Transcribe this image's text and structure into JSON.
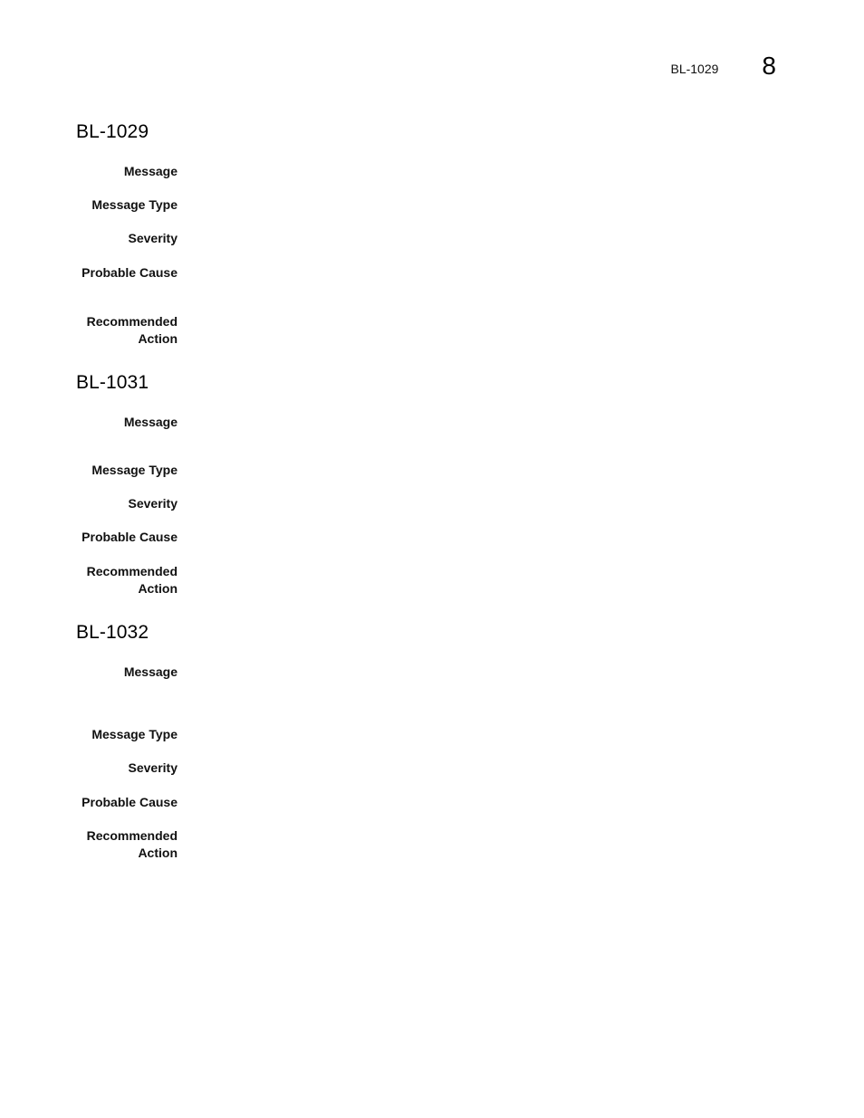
{
  "header": {
    "running_title": "BL-1029",
    "chapter_number": "8"
  },
  "sections": [
    {
      "title": "BL-1029",
      "fields": [
        {
          "label": "Message",
          "value": ""
        },
        {
          "label": "Message Type",
          "value": ""
        },
        {
          "label": "Severity",
          "value": ""
        },
        {
          "label": "Probable Cause",
          "value": ""
        },
        {
          "label_line1": "Recommended",
          "label_line2": "Action",
          "value": ""
        }
      ]
    },
    {
      "title": "BL-1031",
      "fields": [
        {
          "label": "Message",
          "value": ""
        },
        {
          "label": "Message Type",
          "value": ""
        },
        {
          "label": "Severity",
          "value": ""
        },
        {
          "label": "Probable Cause",
          "value": ""
        },
        {
          "label_line1": "Recommended",
          "label_line2": "Action",
          "value": ""
        }
      ]
    },
    {
      "title": "BL-1032",
      "fields": [
        {
          "label": "Message",
          "value": ""
        },
        {
          "label": "Message Type",
          "value": ""
        },
        {
          "label": "Severity",
          "value": ""
        },
        {
          "label": "Probable Cause",
          "value": ""
        },
        {
          "label_line1": "Recommended",
          "label_line2": "Action",
          "value": ""
        }
      ]
    }
  ]
}
